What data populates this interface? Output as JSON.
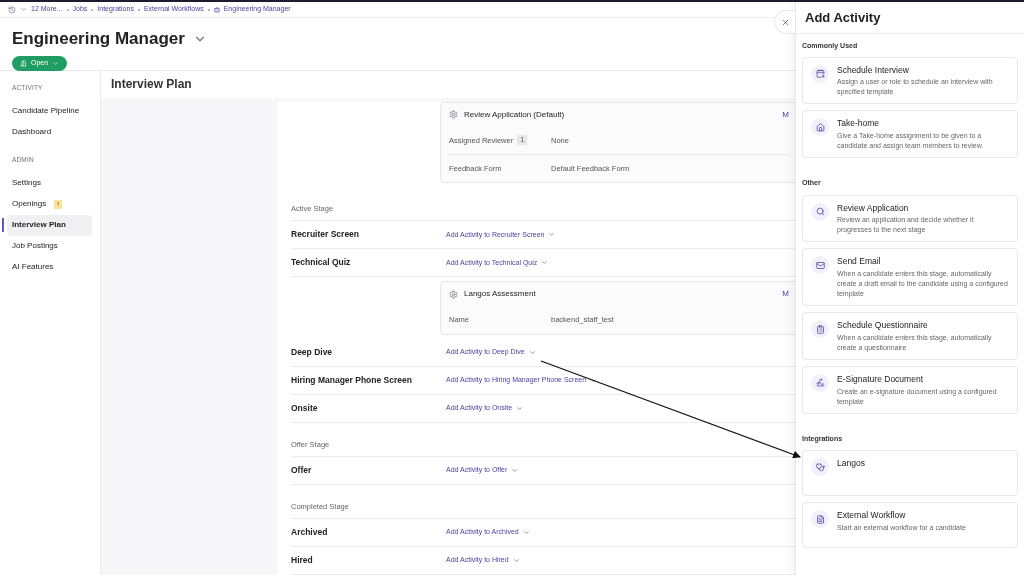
{
  "breadcrumbs": [
    {
      "label": "12 More..."
    },
    {
      "label": "Jobs"
    },
    {
      "label": "Integrations"
    },
    {
      "label": "External Workflows"
    },
    {
      "label": "Engineering Manager",
      "kind": "job"
    }
  ],
  "header": {
    "title": "Engineering Manager",
    "status": "Open"
  },
  "sidebar": [
    {
      "heading": "ACTIVITY",
      "items": [
        {
          "label": "Candidate Pipeline",
          "selected": false
        },
        {
          "label": "Dashboard",
          "selected": false
        }
      ]
    },
    {
      "heading": "ADMIN",
      "items": [
        {
          "label": "Settings",
          "selected": false
        },
        {
          "label": "Openings",
          "selected": false,
          "badge": "!"
        },
        {
          "label": "Interview Plan",
          "selected": true
        },
        {
          "label": "Job Postings",
          "selected": false
        },
        {
          "label": "AI Features",
          "selected": false
        }
      ]
    }
  ],
  "main": {
    "title": "Interview Plan",
    "rows": [
      {
        "kind": "card",
        "title": "Review Application (Default)",
        "more": "M",
        "fields": [
          {
            "label": "Assigned Reviewer",
            "badge": "1",
            "value": "None"
          },
          {
            "label": "Feedback Form",
            "value": "Default Feedback Form"
          }
        ]
      },
      {
        "kind": "group",
        "label": "Active Stage"
      },
      {
        "kind": "stage",
        "name": "Recruiter Screen",
        "action": "Add Activity to Recruiter Screen"
      },
      {
        "kind": "stage",
        "name": "Technical Quiz",
        "action": "Add Activity to Technical Quiz"
      },
      {
        "kind": "card",
        "title": "Langos Assessment",
        "more": "M",
        "fields": [
          {
            "label": "Name",
            "value": "backend_staff_test"
          }
        ]
      },
      {
        "kind": "stage",
        "name": "Deep Dive",
        "action": "Add Activity to Deep Dive"
      },
      {
        "kind": "stage",
        "name": "Hiring Manager Phone Screen",
        "action": "Add Activity to Hiring Manager Phone Screen"
      },
      {
        "kind": "stage",
        "name": "Onsite",
        "action": "Add Activity to Onsite"
      },
      {
        "kind": "group",
        "label": "Offer Stage"
      },
      {
        "kind": "stage",
        "name": "Offer",
        "action": "Add Activity to Offer"
      },
      {
        "kind": "group",
        "label": "Completed Stage"
      },
      {
        "kind": "stage",
        "name": "Archived",
        "action": "Add Activity to Archived"
      },
      {
        "kind": "stage",
        "name": "Hired",
        "action": "Add Activity to Hired"
      }
    ]
  },
  "drawer": {
    "title": "Add Activity",
    "sections": [
      {
        "heading": "Commonly Used",
        "items": [
          {
            "kind": "calendar",
            "title": "Schedule Interview",
            "description": "Assign a user or role to schedule an interview with specified template"
          },
          {
            "kind": "house",
            "title": "Take-home",
            "description": "Give a Take-home assignment to be given to a candidate and assign team members to review."
          }
        ]
      },
      {
        "heading": "Other",
        "items": [
          {
            "kind": "search",
            "title": "Review Application",
            "description": "Review an application and decide whether it progresses to the next stage"
          },
          {
            "kind": "mail",
            "title": "Send Email",
            "description": "When a candidate enters this stage, automatically create a draft email to the candidate using a configured template"
          },
          {
            "kind": "clipboard",
            "title": "Schedule Questionnaire",
            "description": "When a candidate enters this stage, automatically create a questionnaire"
          },
          {
            "kind": "signature",
            "title": "E-Signature Document",
            "description": "Create an e-signature document using a configured template"
          }
        ]
      },
      {
        "heading": "Integrations",
        "items": [
          {
            "kind": "stethoscope",
            "title": "Langos"
          },
          {
            "kind": "file",
            "title": "External Workflow",
            "description": "Start an external workflow for a candidate"
          }
        ]
      }
    ]
  }
}
